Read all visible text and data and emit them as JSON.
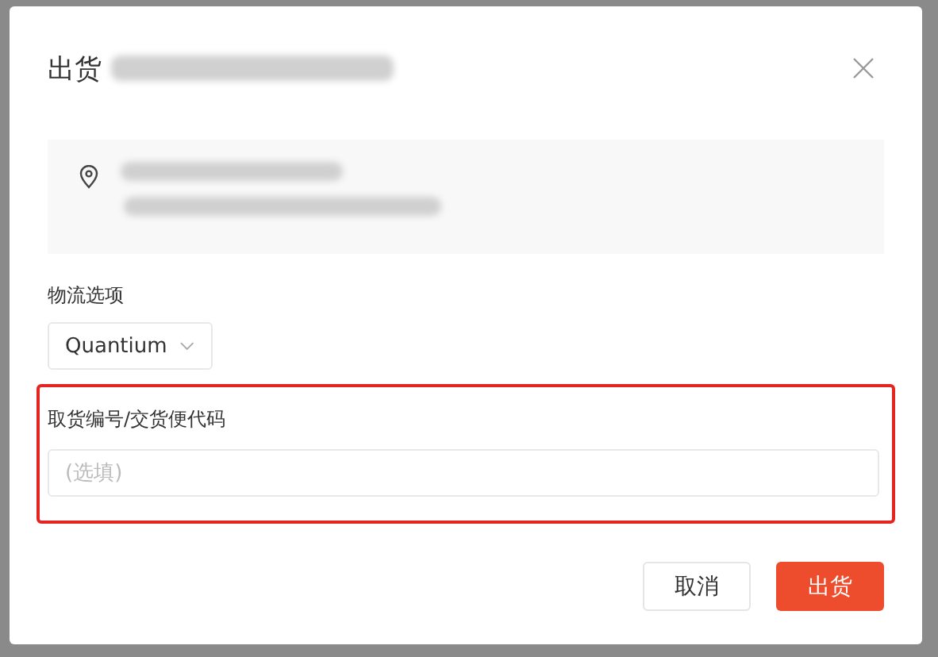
{
  "dialog": {
    "title": "出货"
  },
  "logistics": {
    "label": "物流选项",
    "value": "Quantium"
  },
  "pickup_code": {
    "label": "取货编号/交货便代码",
    "placeholder": "(选填)",
    "highlighted": true
  },
  "buttons": [
    {
      "label": "取消",
      "kind": "secondary"
    },
    {
      "label": "出货",
      "kind": "primary"
    }
  ]
}
